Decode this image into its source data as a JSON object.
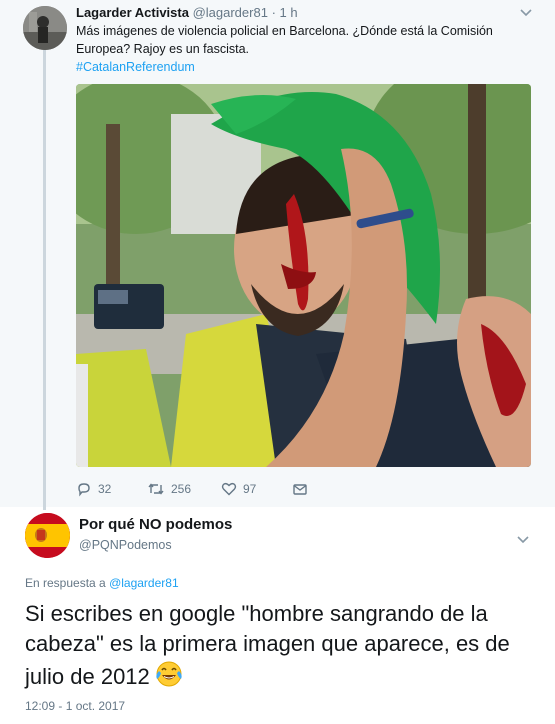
{
  "parent_tweet": {
    "display_name": "Lagarder Activista",
    "handle": "@lagarder81",
    "separator": "·",
    "time_ago": "1 h",
    "text": "Más imágenes de violencia policial en Barcelona. ¿Dónde está la Comisión Europea? Rajoy es un fascista.",
    "hashtag": "#CatalanReferendum",
    "photo_icon": "photo-of-injured-protester",
    "actions": {
      "replies": "32",
      "retweets": "256",
      "likes": "97"
    }
  },
  "reply_tweet": {
    "display_name": "Por qué NO podemos",
    "handle": "@PQNPodemos",
    "in_reply_prefix": "En respuesta a ",
    "in_reply_to": "@lagarder81",
    "text": "Si escribes en google \"hombre sangrando de la cabeza\" es la primera imagen que aparece, es de julio de 2012",
    "emoji": "face-with-tears-of-joy",
    "timestamp": "12:09 - 1 oct. 2017"
  },
  "colors": {
    "link_blue": "#1da1f2",
    "muted_gray": "#657786",
    "thread_bg": "#f5f8fa"
  }
}
